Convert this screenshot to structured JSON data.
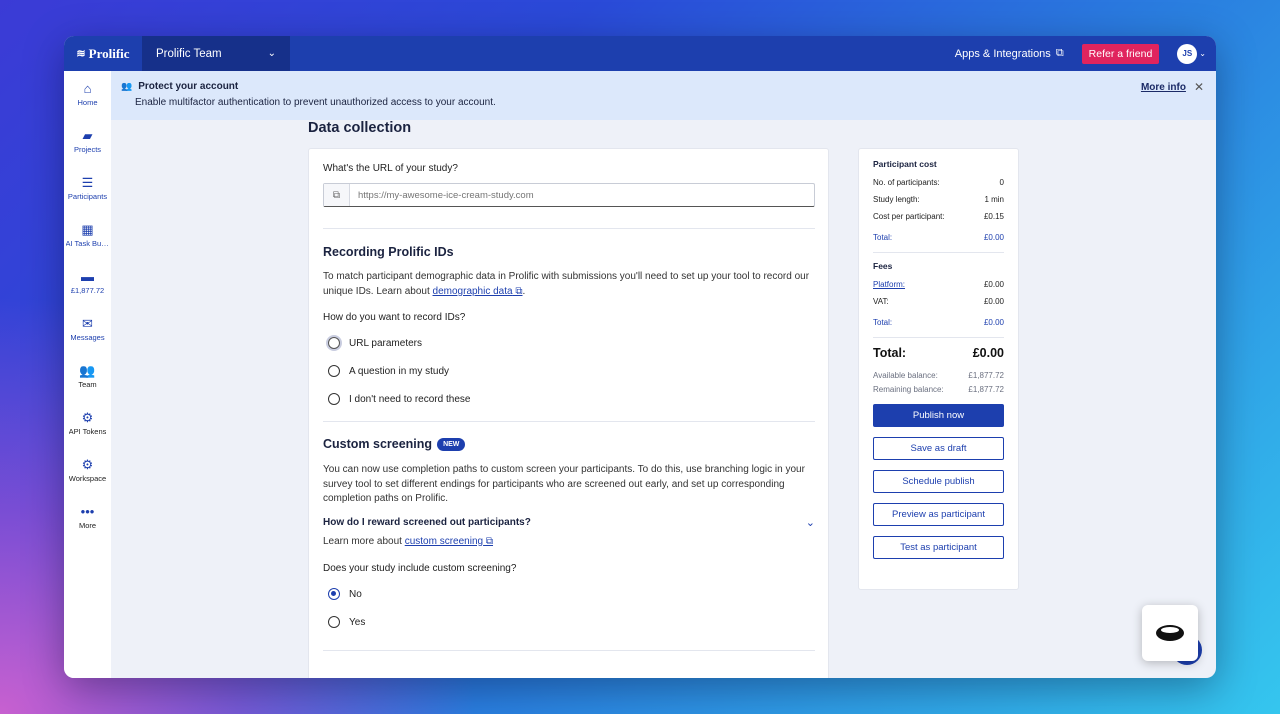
{
  "topbar": {
    "brand": "Prolific",
    "team": "Prolific Team",
    "apps_link": "Apps & Integrations",
    "refer_label": "Refer a friend",
    "avatar_initials": "JS"
  },
  "sidebar": {
    "items": [
      {
        "label": "Home",
        "icon": "home-icon",
        "glyph": "⌂"
      },
      {
        "label": "Projects",
        "icon": "folder-icon",
        "glyph": "▰"
      },
      {
        "label": "Participants",
        "icon": "filter-icon",
        "glyph": "☰"
      },
      {
        "label": "AI Task Builder",
        "icon": "task-icon",
        "glyph": "▦"
      },
      {
        "label": "£1,877.72",
        "icon": "wallet-icon",
        "glyph": "▬"
      },
      {
        "label": "Messages",
        "icon": "mail-icon",
        "glyph": "✉"
      },
      {
        "label": "Team",
        "icon": "team-icon",
        "glyph": "👥"
      },
      {
        "label": "API Tokens",
        "icon": "robot-icon",
        "glyph": "⚙"
      },
      {
        "label": "Workspace",
        "icon": "gear-icon",
        "glyph": "⚙"
      },
      {
        "label": "More",
        "icon": "more-icon",
        "glyph": "•••"
      }
    ]
  },
  "banner": {
    "title": "Protect your account",
    "text": "Enable multifactor authentication to prevent unauthorized access to your account.",
    "more_info": "More info"
  },
  "main": {
    "section_title": "Data collection",
    "url_question": "What's the URL of your study?",
    "url_placeholder": "https://my-awesome-ice-cream-study.com",
    "recording": {
      "title": "Recording Prolific IDs",
      "text": "To match participant demographic data in Prolific with submissions you'll need to set up your tool to record our unique IDs. Learn about ",
      "link": "demographic data",
      "text_end": ".",
      "question": "How do you want to record IDs?",
      "options": [
        "URL parameters",
        "A question in my study",
        "I don't need to record these"
      ]
    },
    "screening": {
      "title": "Custom screening",
      "badge": "NEW",
      "text": "You can now use completion paths to custom screen your participants. To do this, use branching logic in your survey tool to set different endings for participants who are screened out early, and set up corresponding completion paths on Prolific.",
      "accordion": "How do I reward screened out participants?",
      "learn_prefix": "Learn more about ",
      "learn_link": "custom screening",
      "question": "Does your study include custom screening?",
      "options": [
        "No",
        "Yes"
      ]
    }
  },
  "summary": {
    "participant_cost_title": "Participant cost",
    "rows": [
      {
        "label": "No. of participants:",
        "value": "0"
      },
      {
        "label": "Study length:",
        "value": "1 min"
      },
      {
        "label": "Cost per participant:",
        "value": "£0.15"
      }
    ],
    "subtotal_label": "Total:",
    "subtotal_value": "£0.00",
    "fees_title": "Fees",
    "platform_label": "Platform:",
    "platform_value": "£0.00",
    "vat_label": "VAT:",
    "vat_value": "£0.00",
    "fees_total_label": "Total:",
    "fees_total_value": "£0.00",
    "grand_total_label": "Total:",
    "grand_total_value": "£0.00",
    "available_label": "Available balance:",
    "available_value": "£1,877.72",
    "remaining_label": "Remaining balance:",
    "remaining_value": "£1,877.72",
    "buttons": {
      "publish": "Publish now",
      "draft": "Save as draft",
      "schedule": "Schedule publish",
      "preview": "Preview as participant",
      "test": "Test as participant"
    }
  },
  "colors": {
    "brand_blue": "#1d3fae",
    "refer_pink": "#e0245e",
    "banner_bg": "#dce8fb"
  }
}
